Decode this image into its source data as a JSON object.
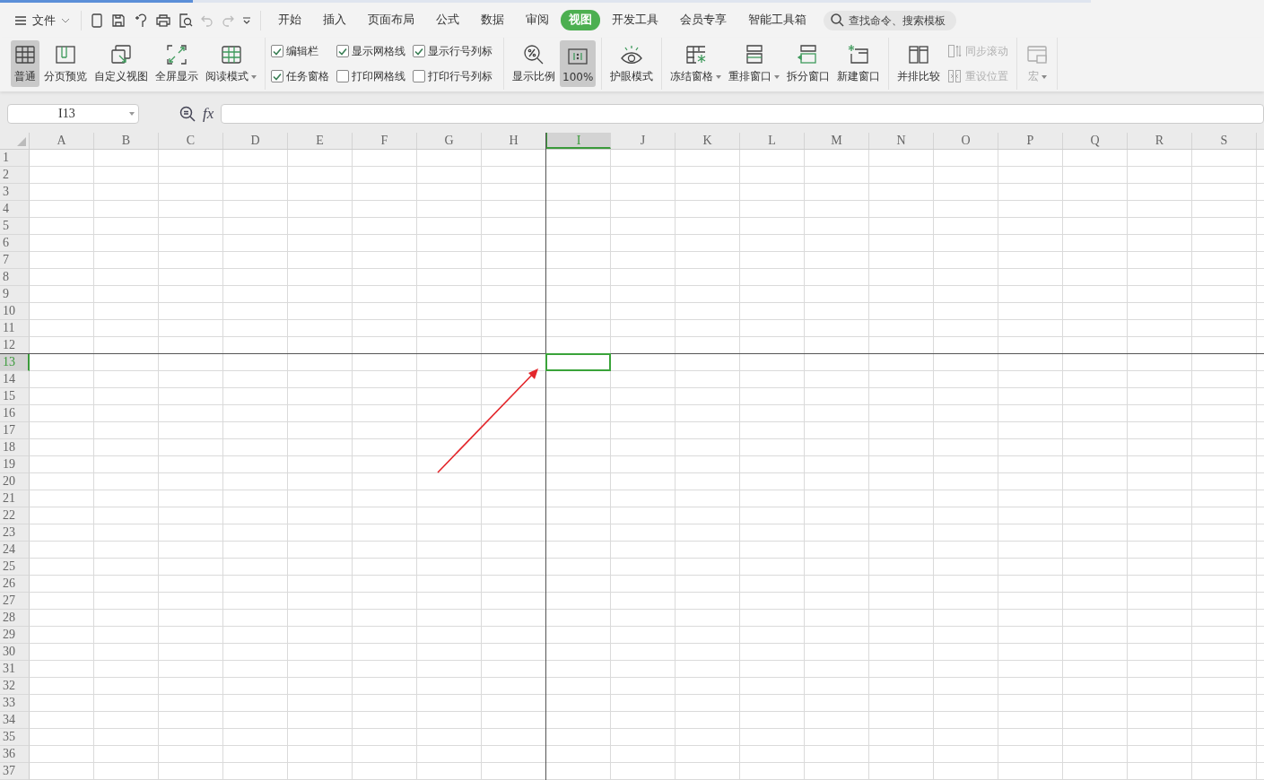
{
  "menu": {
    "file_label": "文件",
    "tabs": [
      {
        "label": "开始",
        "selected": false
      },
      {
        "label": "插入",
        "selected": false
      },
      {
        "label": "页面布局",
        "selected": false
      },
      {
        "label": "公式",
        "selected": false
      },
      {
        "label": "数据",
        "selected": false
      },
      {
        "label": "审阅",
        "selected": false
      },
      {
        "label": "视图",
        "selected": true
      },
      {
        "label": "开发工具",
        "selected": false
      },
      {
        "label": "会员专享",
        "selected": false
      },
      {
        "label": "智能工具箱",
        "selected": false
      }
    ],
    "search": {
      "placeholder": "查找命令、搜索模板"
    }
  },
  "ribbon": [
    {
      "items": [
        {
          "kind": "large",
          "label": "普通",
          "selected": true,
          "dropdown": false,
          "disabled": false
        },
        {
          "kind": "large",
          "label": "分页预览",
          "selected": false,
          "dropdown": false,
          "disabled": false
        },
        {
          "kind": "large",
          "label": "自定义视图",
          "selected": false,
          "dropdown": false,
          "disabled": false
        },
        {
          "kind": "large",
          "label": "全屏显示",
          "selected": false,
          "dropdown": false,
          "disabled": false
        },
        {
          "kind": "large",
          "label": "阅读模式",
          "selected": false,
          "dropdown": true,
          "disabled": false
        }
      ]
    },
    {
      "items": [
        {
          "kind": "checkbox",
          "label": "编辑栏",
          "checked": true
        },
        {
          "kind": "checkbox",
          "label": "任务窗格",
          "checked": true
        },
        {
          "kind": "checkbox",
          "label": "显示网格线",
          "checked": true
        },
        {
          "kind": "checkbox",
          "label": "打印网格线",
          "checked": false
        },
        {
          "kind": "checkbox",
          "label": "显示行号列标",
          "checked": true
        },
        {
          "kind": "checkbox",
          "label": "打印行号列标",
          "checked": false
        }
      ]
    },
    {
      "items": [
        {
          "kind": "large",
          "label": "显示比例",
          "selected": false,
          "dropdown": false,
          "disabled": false
        },
        {
          "kind": "large",
          "label": "100%",
          "selected": true,
          "dropdown": false,
          "disabled": false
        }
      ]
    },
    {
      "items": [
        {
          "kind": "large",
          "label": "护眼模式",
          "selected": false,
          "dropdown": false,
          "disabled": false
        }
      ]
    },
    {
      "items": [
        {
          "kind": "large",
          "label": "冻结窗格",
          "selected": false,
          "dropdown": true,
          "disabled": false
        },
        {
          "kind": "large",
          "label": "重排窗口",
          "selected": false,
          "dropdown": true,
          "disabled": false
        },
        {
          "kind": "large",
          "label": "拆分窗口",
          "selected": false,
          "dropdown": false,
          "disabled": false
        },
        {
          "kind": "large",
          "label": "新建窗口",
          "selected": false,
          "dropdown": false,
          "disabled": false
        }
      ]
    },
    {
      "items": [
        {
          "kind": "large",
          "label": "并排比较",
          "selected": false,
          "dropdown": false,
          "disabled": false
        },
        {
          "kind": "small",
          "label": "同步滚动",
          "disabled": true
        },
        {
          "kind": "small",
          "label": "重设位置",
          "disabled": true
        }
      ]
    },
    {
      "items": [
        {
          "kind": "large",
          "label": "宏",
          "selected": false,
          "dropdown": true,
          "disabled": true
        }
      ]
    }
  ],
  "formula_bar": {
    "name_box": "I13",
    "function_label": "fx"
  },
  "sheet": {
    "freeze_panes": true,
    "columns": [
      {
        "label": "A",
        "selected": false
      },
      {
        "label": "B",
        "selected": false
      },
      {
        "label": "C",
        "selected": false
      },
      {
        "label": "D",
        "selected": false
      },
      {
        "label": "E",
        "selected": false
      },
      {
        "label": "F",
        "selected": false
      },
      {
        "label": "G",
        "selected": false
      },
      {
        "label": "H",
        "selected": false
      },
      {
        "label": "I",
        "selected": true
      },
      {
        "label": "J",
        "selected": false
      },
      {
        "label": "K",
        "selected": false
      },
      {
        "label": "L",
        "selected": false
      },
      {
        "label": "M",
        "selected": false
      },
      {
        "label": "N",
        "selected": false
      },
      {
        "label": "O",
        "selected": false
      },
      {
        "label": "P",
        "selected": false
      },
      {
        "label": "Q",
        "selected": false
      },
      {
        "label": "R",
        "selected": false
      },
      {
        "label": "S",
        "selected": false
      }
    ],
    "rows": [
      {
        "label": "1",
        "selected": false
      },
      {
        "label": "2",
        "selected": false
      },
      {
        "label": "3",
        "selected": false
      },
      {
        "label": "4",
        "selected": false
      },
      {
        "label": "5",
        "selected": false
      },
      {
        "label": "6",
        "selected": false
      },
      {
        "label": "7",
        "selected": false
      },
      {
        "label": "8",
        "selected": false
      },
      {
        "label": "9",
        "selected": false
      },
      {
        "label": "10",
        "selected": false
      },
      {
        "label": "11",
        "selected": false
      },
      {
        "label": "12",
        "selected": false
      },
      {
        "label": "13",
        "selected": true
      },
      {
        "label": "14",
        "selected": false
      },
      {
        "label": "15",
        "selected": false
      },
      {
        "label": "16",
        "selected": false
      },
      {
        "label": "17",
        "selected": false
      },
      {
        "label": "18",
        "selected": false
      },
      {
        "label": "19",
        "selected": false
      },
      {
        "label": "20",
        "selected": false
      },
      {
        "label": "21",
        "selected": false
      },
      {
        "label": "22",
        "selected": false
      },
      {
        "label": "23",
        "selected": false
      },
      {
        "label": "24",
        "selected": false
      },
      {
        "label": "25",
        "selected": false
      },
      {
        "label": "26",
        "selected": false
      },
      {
        "label": "27",
        "selected": false
      },
      {
        "label": "28",
        "selected": false
      },
      {
        "label": "29",
        "selected": false
      },
      {
        "label": "30",
        "selected": false
      },
      {
        "label": "31",
        "selected": false
      },
      {
        "label": "32",
        "selected": false
      },
      {
        "label": "33",
        "selected": false
      },
      {
        "label": "34",
        "selected": false
      },
      {
        "label": "35",
        "selected": false
      },
      {
        "label": "36",
        "selected": false
      },
      {
        "label": "37",
        "selected": false
      }
    ]
  }
}
